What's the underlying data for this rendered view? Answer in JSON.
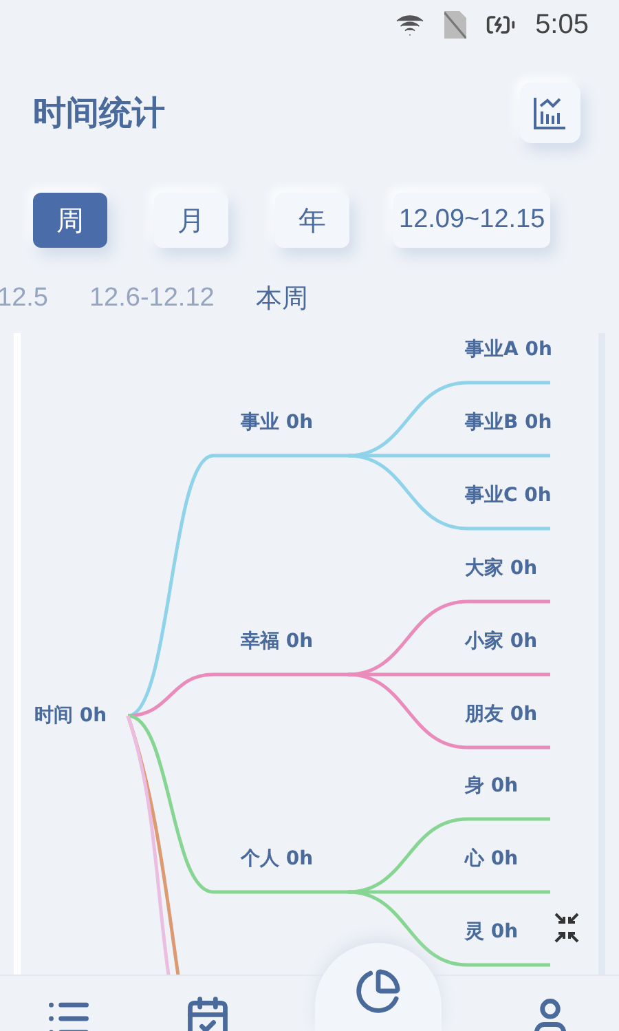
{
  "status_bar": {
    "time": "5:05"
  },
  "header": {
    "title": "时间统计"
  },
  "range_tabs": [
    {
      "label": "周",
      "selected": true
    },
    {
      "label": "月",
      "selected": false
    },
    {
      "label": "年",
      "selected": false
    }
  ],
  "date_range": "12.09~12.15",
  "periods": [
    {
      "label": "12.5",
      "selected": false
    },
    {
      "label": "12.6-12.12",
      "selected": false
    },
    {
      "label": "本周",
      "selected": true
    }
  ],
  "mind_map": {
    "root": "时间 0h",
    "branches": [
      {
        "label": "事业 0h",
        "color": "#8fd3ea",
        "children": [
          {
            "label": "事业A 0h"
          },
          {
            "label": "事业B 0h"
          },
          {
            "label": "事业C 0h"
          }
        ]
      },
      {
        "label": "幸福 0h",
        "color": "#ea8cbb",
        "children": [
          {
            "label": "大家 0h"
          },
          {
            "label": "小家 0h"
          },
          {
            "label": "朋友 0h"
          }
        ]
      },
      {
        "label": "个人 0h",
        "color": "#86d592",
        "children": [
          {
            "label": "身 0h"
          },
          {
            "label": "心 0h"
          },
          {
            "label": "灵 0h"
          }
        ]
      },
      {
        "color": "#dc9a72"
      },
      {
        "color": "#ebbde0"
      }
    ]
  },
  "bottom_nav": [
    {
      "kind": "list",
      "selected": false
    },
    {
      "kind": "calendar",
      "selected": false
    },
    {
      "kind": "chart",
      "selected": true
    },
    {
      "kind": "profile",
      "selected": false
    }
  ]
}
